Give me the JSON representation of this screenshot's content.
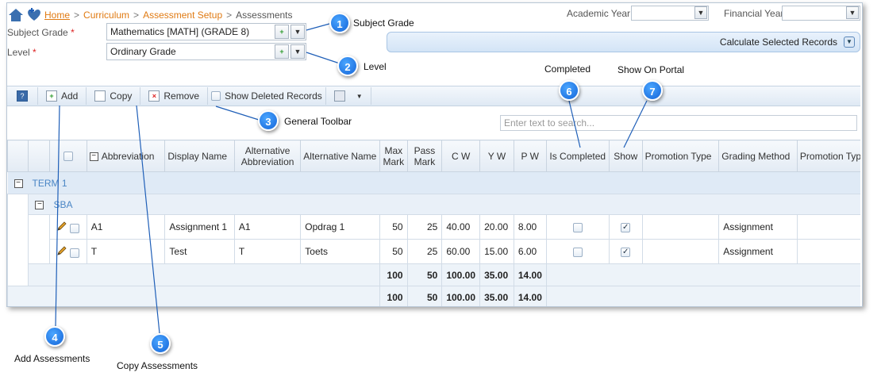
{
  "breadcrumb": {
    "home": "Home",
    "sep": ">",
    "curriculum": "Curriculum",
    "assessment_setup": "Assessment Setup",
    "current": "Assessments"
  },
  "filters": {
    "academic_year_label": "Academic Year",
    "academic_year_value": "",
    "financial_year_label": "Financial Year",
    "financial_year_value": "",
    "subject_grade_label": "Subject Grade",
    "subject_grade_value": "Mathematics [MATH] (GRADE 8)",
    "level_label": "Level",
    "level_value": "Ordinary Grade",
    "required_mark": "*"
  },
  "calculate_label": "Calculate Selected Records",
  "toolbar": {
    "add": "Add",
    "copy": "Copy",
    "remove": "Remove",
    "show_deleted": "Show Deleted Records"
  },
  "search": {
    "placeholder": "Enter text to search..."
  },
  "columns": [
    "Abbreviation",
    "Display Name",
    "Alternative Abbreviation",
    "Alternative Name",
    "Max Mark",
    "Pass Mark",
    "C W",
    "Y W",
    "P W",
    "Is Completed",
    "Show",
    "Promotion Type",
    "Grading Method",
    "Promotion Typ"
  ],
  "col_hdr": {
    "abbr": "Abbreviation",
    "disp": "Display Name",
    "alt_abbr_1": "Alternative",
    "alt_abbr_2": "Abbreviation",
    "alt_name": "Alternative Name",
    "max_1": "Max",
    "max_2": "Mark",
    "pass_1": "Pass",
    "pass_2": "Mark",
    "cw": "C W",
    "yw": "Y W",
    "pw": "P W",
    "completed": "Is Completed",
    "show": "Show",
    "promo": "Promotion Type",
    "grading": "Grading Method",
    "promo2": "Promotion Typ"
  },
  "groups": {
    "term": "TERM 1",
    "sub": "SBA"
  },
  "rows": [
    {
      "abbr": "A1",
      "display": "Assignment 1",
      "alt_abbr": "A1",
      "alt_name": "Opdrag 1",
      "max": "50",
      "pass": "25",
      "cw": "40.00",
      "yw": "20.00",
      "pw": "8.00",
      "completed": false,
      "show": true,
      "promotion": "",
      "grading": "Assignment"
    },
    {
      "abbr": "T",
      "display": "Test",
      "alt_abbr": "T",
      "alt_name": "Toets",
      "max": "50",
      "pass": "25",
      "cw": "60.00",
      "yw": "15.00",
      "pw": "6.00",
      "completed": false,
      "show": true,
      "promotion": "",
      "grading": "Assignment"
    }
  ],
  "totals": [
    {
      "max": "100",
      "pass": "50",
      "cw": "100.00",
      "yw": "35.00",
      "pw": "14.00"
    },
    {
      "max": "100",
      "pass": "50",
      "cw": "100.00",
      "yw": "35.00",
      "pw": "14.00"
    }
  ],
  "callouts": [
    {
      "num": "1",
      "text": "Subject Grade"
    },
    {
      "num": "2",
      "text": "Level"
    },
    {
      "num": "3",
      "text": "General Toolbar"
    },
    {
      "num": "4",
      "text": "Add Assessments"
    },
    {
      "num": "5",
      "text": "Copy Assessments"
    },
    {
      "num": "6",
      "text": "Completed"
    },
    {
      "num": "7",
      "text": "Show On Portal"
    }
  ],
  "colors": {
    "accent": "#1464d8",
    "link": "#e07a12",
    "group_text": "#4a86c5"
  }
}
